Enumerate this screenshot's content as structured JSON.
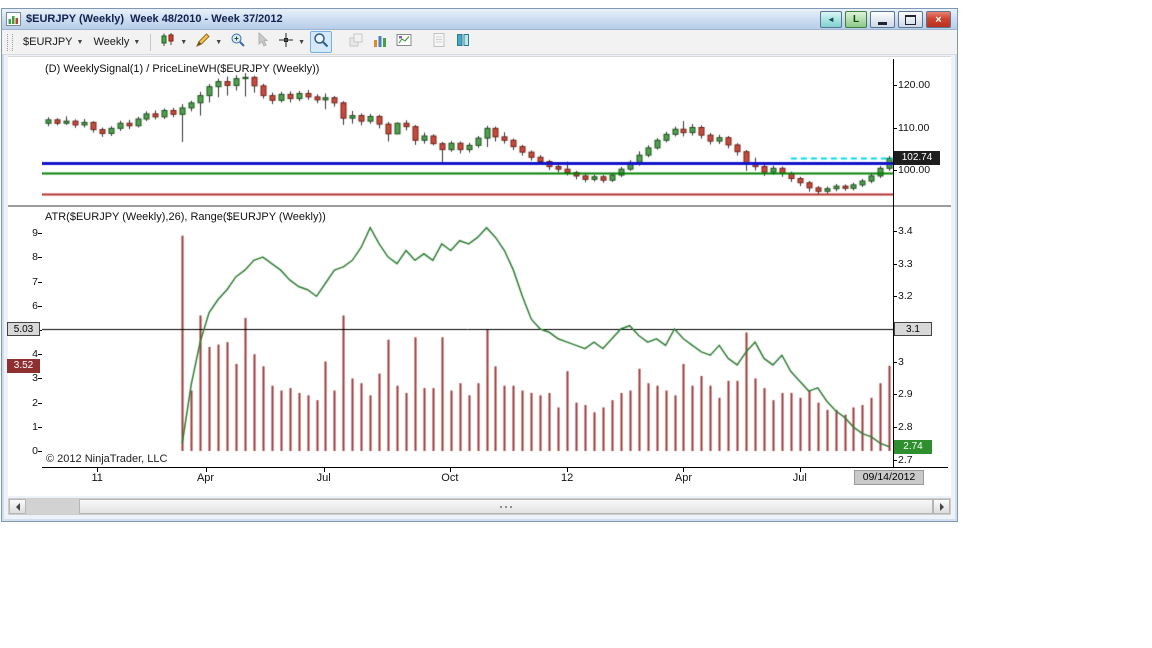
{
  "window": {
    "title": "$EURJPY (Weekly)  Week 48/2010 - Week 37/2012",
    "link_label": "L"
  },
  "toolbar": {
    "instrument": "$EURJPY",
    "interval": "Weekly",
    "buttons": [
      {
        "name": "chart-style",
        "icon": "candles",
        "dropdown": true
      },
      {
        "name": "drawing-tools",
        "icon": "pencil",
        "dropdown": true
      },
      {
        "name": "zoom-in",
        "icon": "zoom-in",
        "dropdown": false
      },
      {
        "name": "pointer",
        "icon": "pointer",
        "dropdown": false,
        "disabled": true
      },
      {
        "name": "crosshair",
        "icon": "crosshair",
        "dropdown": true
      },
      {
        "name": "magnifier",
        "icon": "magnifier",
        "dropdown": false,
        "active": true
      },
      {
        "name": "bring-to-front",
        "icon": "layers",
        "disabled": true,
        "gap": true
      },
      {
        "name": "data-grid",
        "icon": "bars"
      },
      {
        "name": "chart-trader",
        "icon": "chart-image"
      },
      {
        "name": "notes",
        "icon": "notepad",
        "disabled": true,
        "gap": true
      },
      {
        "name": "data-columns",
        "icon": "columns"
      }
    ]
  },
  "chart_data": [
    {
      "type": "candlestick",
      "title": "(D) WeeklySignal(1) / PriceLineWH($EURJPY (Weekly))",
      "symbol": "$EURJPY",
      "interval": "Weekly",
      "x_range_label": "Week 48/2010 - Week 37/2012",
      "y_labels": [
        120,
        110,
        100
      ],
      "y_range": [
        91.5,
        126.8
      ],
      "last_price": 102.74,
      "last_price_label": "102.74",
      "hlines": [
        {
          "name": "priceline-blue",
          "value": 101.65,
          "color": "#1414cc",
          "width": 3
        },
        {
          "name": "priceline-green",
          "value": 99.3,
          "color": "#008000",
          "width": 2
        },
        {
          "name": "priceline-red",
          "value": 94.4,
          "color": "#b63030",
          "width": 2
        }
      ],
      "dashed_line": {
        "value": 102.74,
        "color": "#00dbe8",
        "start_index": 83
      },
      "colors": {
        "up": "#4fa14f",
        "down": "#c84b3c",
        "outline_up": "#1e4f1e",
        "outline_down": "#6e231a",
        "wick": "#333333"
      },
      "candles": [
        [
          111.0,
          112.4,
          110.3,
          111.8
        ],
        [
          111.8,
          112.2,
          110.5,
          111.0
        ],
        [
          111.0,
          112.6,
          110.6,
          111.5
        ],
        [
          111.5,
          111.9,
          109.9,
          110.6
        ],
        [
          110.6,
          112.0,
          110.0,
          111.2
        ],
        [
          111.2,
          111.5,
          108.8,
          109.5
        ],
        [
          109.5,
          110.0,
          107.8,
          108.6
        ],
        [
          108.6,
          110.3,
          108.0,
          109.8
        ],
        [
          109.8,
          111.6,
          109.2,
          111.0
        ],
        [
          111.0,
          111.8,
          109.6,
          110.4
        ],
        [
          110.4,
          112.5,
          110.0,
          112.0
        ],
        [
          112.0,
          113.8,
          111.5,
          113.2
        ],
        [
          113.2,
          114.0,
          111.9,
          112.5
        ],
        [
          112.5,
          114.5,
          112.0,
          114.0
        ],
        [
          114.0,
          114.6,
          112.4,
          113.1
        ],
        [
          113.1,
          115.5,
          106.6,
          114.6
        ],
        [
          114.6,
          116.3,
          113.8,
          115.8
        ],
        [
          115.8,
          118.4,
          112.8,
          117.5
        ],
        [
          117.5,
          120.2,
          115.9,
          119.6
        ],
        [
          119.6,
          121.5,
          117.1,
          120.8
        ],
        [
          120.8,
          122.0,
          117.5,
          119.9
        ],
        [
          119.9,
          122.3,
          118.7,
          121.5
        ],
        [
          121.5,
          122.8,
          117.3,
          121.8
        ],
        [
          121.8,
          122.2,
          118.2,
          119.8
        ],
        [
          119.8,
          120.3,
          116.8,
          117.5
        ],
        [
          117.5,
          118.2,
          115.5,
          116.4
        ],
        [
          116.4,
          118.4,
          115.9,
          117.8
        ],
        [
          117.8,
          118.5,
          115.9,
          116.8
        ],
        [
          116.8,
          118.6,
          116.2,
          118.0
        ],
        [
          118.0,
          118.8,
          116.5,
          117.2
        ],
        [
          117.2,
          117.8,
          115.7,
          116.5
        ],
        [
          116.5,
          118.0,
          114.3,
          117.0
        ],
        [
          117.0,
          117.4,
          114.9,
          115.8
        ],
        [
          115.8,
          116.2,
          110.6,
          112.2
        ],
        [
          112.2,
          113.9,
          110.9,
          112.8
        ],
        [
          112.8,
          113.3,
          110.5,
          111.5
        ],
        [
          111.5,
          113.2,
          110.9,
          112.6
        ],
        [
          112.6,
          113.0,
          109.8,
          110.8
        ],
        [
          110.8,
          111.3,
          106.7,
          108.5
        ],
        [
          108.5,
          111.2,
          108.5,
          111.0
        ],
        [
          111.0,
          111.7,
          109.3,
          110.2
        ],
        [
          110.2,
          110.6,
          105.9,
          107.0
        ],
        [
          107.0,
          108.8,
          106.2,
          108.0
        ],
        [
          108.0,
          108.4,
          105.8,
          106.2
        ],
        [
          106.2,
          106.6,
          101.9,
          104.8
        ],
        [
          104.8,
          106.8,
          104.3,
          106.3
        ],
        [
          106.3,
          106.7,
          103.9,
          104.8
        ],
        [
          104.8,
          106.4,
          104.1,
          105.8
        ],
        [
          105.8,
          108.0,
          105.2,
          107.5
        ],
        [
          107.5,
          110.4,
          105.4,
          109.8
        ],
        [
          109.8,
          110.2,
          106.7,
          107.8
        ],
        [
          107.8,
          108.9,
          106.2,
          107.0
        ],
        [
          107.0,
          107.4,
          104.7,
          105.5
        ],
        [
          105.5,
          105.9,
          103.4,
          104.2
        ],
        [
          104.2,
          104.6,
          102.2,
          103.0
        ],
        [
          103.0,
          103.5,
          101.2,
          102.0
        ],
        [
          102.0,
          102.4,
          100.0,
          100.8
        ],
        [
          100.8,
          101.3,
          99.5,
          100.2
        ],
        [
          100.2,
          102.0,
          98.7,
          99.4
        ],
        [
          99.4,
          99.8,
          97.8,
          98.6
        ],
        [
          98.6,
          99.0,
          97.1,
          97.8
        ],
        [
          97.8,
          98.9,
          97.3,
          98.4
        ],
        [
          98.4,
          98.8,
          97.0,
          97.6
        ],
        [
          97.6,
          99.3,
          97.2,
          98.8
        ],
        [
          98.8,
          100.7,
          98.3,
          100.2
        ],
        [
          100.2,
          102.3,
          99.8,
          101.8
        ],
        [
          101.8,
          104.4,
          101.0,
          103.5
        ],
        [
          103.5,
          105.8,
          103.0,
          105.2
        ],
        [
          105.2,
          107.5,
          104.8,
          107.0
        ],
        [
          107.0,
          109.0,
          106.5,
          108.4
        ],
        [
          108.4,
          110.2,
          107.9,
          109.6
        ],
        [
          109.6,
          111.5,
          107.9,
          108.8
        ],
        [
          108.8,
          110.8,
          108.1,
          110.0
        ],
        [
          110.0,
          110.5,
          107.4,
          108.2
        ],
        [
          108.2,
          108.7,
          106.0,
          106.8
        ],
        [
          106.8,
          108.3,
          106.1,
          107.6
        ],
        [
          107.6,
          108.0,
          105.1,
          105.9
        ],
        [
          105.9,
          106.3,
          103.4,
          104.3
        ],
        [
          104.3,
          104.7,
          99.8,
          101.5
        ],
        [
          101.5,
          102.9,
          99.9,
          100.8
        ],
        [
          100.8,
          101.2,
          98.6,
          99.5
        ],
        [
          99.5,
          101.0,
          98.9,
          100.4
        ],
        [
          100.4,
          100.8,
          98.4,
          99.2
        ],
        [
          99.2,
          99.6,
          97.2,
          98.0
        ],
        [
          98.0,
          98.4,
          96.2,
          97.0
        ],
        [
          97.0,
          97.4,
          94.9,
          95.8
        ],
        [
          95.8,
          96.2,
          94.2,
          95.0
        ],
        [
          95.0,
          96.1,
          94.4,
          95.6
        ],
        [
          95.6,
          96.7,
          95.0,
          96.2
        ],
        [
          96.2,
          96.6,
          95.1,
          95.7
        ],
        [
          95.7,
          97.0,
          95.2,
          96.5
        ],
        [
          96.5,
          97.9,
          96.0,
          97.4
        ],
        [
          97.4,
          99.1,
          96.9,
          98.6
        ],
        [
          98.6,
          100.9,
          98.1,
          100.4
        ],
        [
          100.4,
          103.3,
          99.8,
          102.74
        ]
      ]
    },
    {
      "type": "bar+line",
      "title": "ATR($EURJPY (Weekly),26), Range($EURJPY (Weekly))",
      "left_labels": [
        9,
        8,
        7,
        6,
        5,
        4,
        3,
        2,
        1,
        0
      ],
      "left_range": [
        0,
        10
      ],
      "right_labels": [
        3.4,
        3.3,
        3.2,
        3.1,
        3,
        2.9,
        2.8,
        2.7
      ],
      "right_range": [
        2.67,
        3.45
      ],
      "start_index": 15,
      "hline_left_value": 5.03,
      "hline_right_value": 3.1,
      "last_range_value": 3.52,
      "last_atr_value": 2.74,
      "tags": {
        "line_left": "5.03",
        "last_range": "3.52",
        "line_right": "3.1",
        "last_atr": "2.74"
      },
      "colors": {
        "range_bar": "#993b3b",
        "atr_line": "#2e7d32",
        "hline": "#000000"
      },
      "range_values": [
        8.9,
        2.5,
        5.6,
        4.3,
        4.4,
        4.5,
        3.6,
        5.5,
        4.0,
        3.5,
        2.7,
        2.5,
        2.6,
        2.4,
        2.3,
        2.1,
        3.7,
        2.5,
        5.6,
        3.0,
        2.8,
        2.3,
        3.2,
        4.6,
        2.7,
        2.4,
        4.7,
        2.6,
        2.6,
        4.7,
        2.5,
        2.8,
        2.3,
        2.8,
        5.0,
        3.5,
        2.7,
        2.7,
        2.5,
        2.4,
        2.3,
        2.4,
        1.8,
        3.3,
        2.0,
        1.9,
        1.6,
        1.8,
        2.1,
        2.4,
        2.5,
        3.4,
        2.8,
        2.7,
        2.5,
        2.3,
        3.6,
        2.7,
        3.1,
        2.7,
        2.2,
        2.9,
        2.9,
        4.9,
        3.0,
        2.6,
        2.1,
        2.4,
        2.4,
        2.2,
        2.5,
        2.0,
        1.7,
        1.7,
        1.5,
        1.8,
        1.9,
        2.2,
        2.8,
        3.52
      ],
      "atr_values": [
        2.75,
        2.93,
        3.06,
        3.15,
        3.19,
        3.22,
        3.26,
        3.28,
        3.31,
        3.32,
        3.3,
        3.28,
        3.25,
        3.23,
        3.22,
        3.2,
        3.24,
        3.28,
        3.29,
        3.31,
        3.35,
        3.41,
        3.36,
        3.32,
        3.3,
        3.34,
        3.31,
        3.33,
        3.31,
        3.36,
        3.34,
        3.37,
        3.36,
        3.38,
        3.41,
        3.38,
        3.34,
        3.28,
        3.2,
        3.13,
        3.1,
        3.09,
        3.07,
        3.06,
        3.05,
        3.04,
        3.06,
        3.04,
        3.07,
        3.1,
        3.11,
        3.08,
        3.06,
        3.07,
        3.05,
        3.1,
        3.07,
        3.05,
        3.03,
        3.02,
        3.05,
        3.01,
        2.99,
        3.03,
        3.06,
        3.01,
        2.99,
        3.02,
        2.97,
        2.94,
        2.91,
        2.92,
        2.88,
        2.85,
        2.83,
        2.8,
        2.78,
        2.77,
        2.75,
        2.74
      ]
    }
  ],
  "x_axis": {
    "ticks": [
      {
        "label": "11",
        "i": 5.5
      },
      {
        "label": "Apr",
        "i": 17.6
      },
      {
        "label": "Jul",
        "i": 30.8
      },
      {
        "label": "Oct",
        "i": 44.9
      },
      {
        "label": "12",
        "i": 58
      },
      {
        "label": "Apr",
        "i": 71
      },
      {
        "label": "Jul",
        "i": 84
      }
    ],
    "last_date": "09/14/2012"
  },
  "footer": {
    "copyright": "© 2012 NinjaTrader, LLC"
  }
}
